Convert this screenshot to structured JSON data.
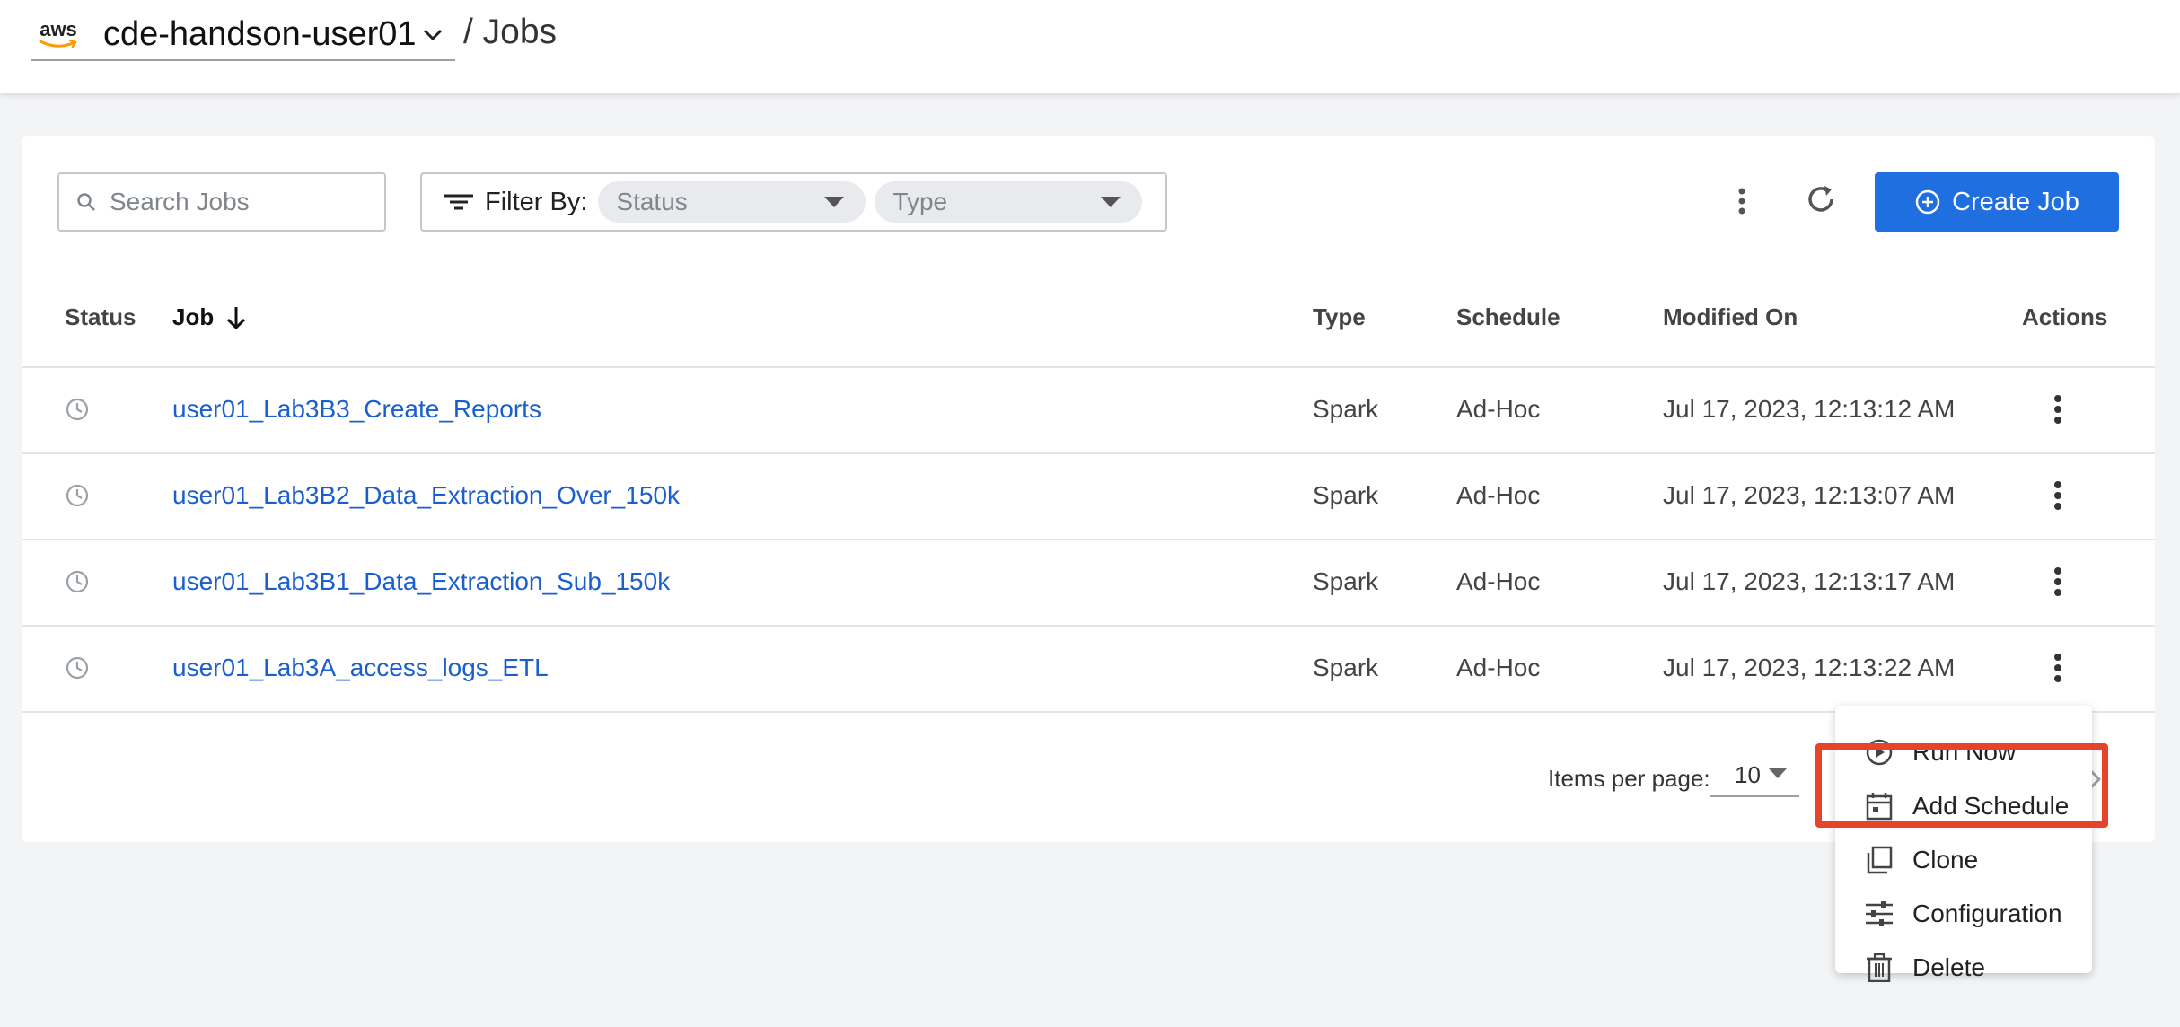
{
  "header": {
    "provider_logo": "aws",
    "environment_name": "cde-handson-user01",
    "breadcrumb": "/ Jobs"
  },
  "toolbar": {
    "search_placeholder": "Search Jobs",
    "filter_label": "Filter By:",
    "status_filter_placeholder": "Status",
    "type_filter_placeholder": "Type",
    "create_label": "Create Job"
  },
  "table": {
    "columns": {
      "status": "Status",
      "job": "Job",
      "type": "Type",
      "schedule": "Schedule",
      "modified_on": "Modified On",
      "actions": "Actions"
    },
    "rows": [
      {
        "name": "user01_Lab3B3_Create_Reports",
        "type": "Spark",
        "schedule": "Ad-Hoc",
        "modified": "Jul 17, 2023, 12:13:12 AM"
      },
      {
        "name": "user01_Lab3B2_Data_Extraction_Over_150k",
        "type": "Spark",
        "schedule": "Ad-Hoc",
        "modified": "Jul 17, 2023, 12:13:07 AM"
      },
      {
        "name": "user01_Lab3B1_Data_Extraction_Sub_150k",
        "type": "Spark",
        "schedule": "Ad-Hoc",
        "modified": "Jul 17, 2023, 12:13:17 AM"
      },
      {
        "name": "user01_Lab3A_access_logs_ETL",
        "type": "Spark",
        "schedule": "Ad-Hoc",
        "modified": "Jul 17, 2023, 12:13:22 AM"
      }
    ]
  },
  "pagination": {
    "items_per_page_label": "Items per page:",
    "items_per_page_value": "10"
  },
  "actions_menu": {
    "items": [
      {
        "label": "Run Now",
        "icon": "play-circle-icon"
      },
      {
        "label": "Add Schedule",
        "icon": "calendar-icon"
      },
      {
        "label": "Clone",
        "icon": "copy-icon"
      },
      {
        "label": "Configuration",
        "icon": "sliders-icon"
      },
      {
        "label": "Delete",
        "icon": "trash-icon"
      }
    ],
    "highlighted_item": "Add Schedule"
  },
  "colors": {
    "accent": "#1f6fe0",
    "link": "#1a5fd0",
    "highlight_border": "#e5432a"
  }
}
